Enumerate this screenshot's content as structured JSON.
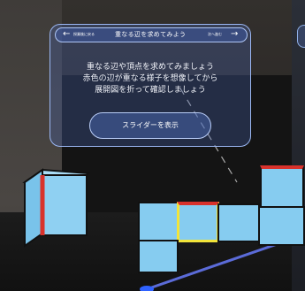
{
  "header": {
    "back_label": "授業後に戻る",
    "title": "重なる辺を求めてみよう",
    "next_label": "次へ進む"
  },
  "instructions": {
    "lines": [
      "重なる辺や頂点を求めてみましょう",
      "赤色の辺が重なる様子を想像してから",
      "展開図を折って確認しましょう"
    ]
  },
  "slider_button": {
    "label": "スライダーを表示"
  },
  "colors": {
    "panel": "#4664AF",
    "panel_border": "#9AB6F2",
    "cube_face": "#86CCF0",
    "highlight_red": "#D8322C",
    "highlight_yellow": "#F2E43A"
  },
  "icons": {
    "back": "left-arrow-icon",
    "next": "right-arrow-icon"
  }
}
